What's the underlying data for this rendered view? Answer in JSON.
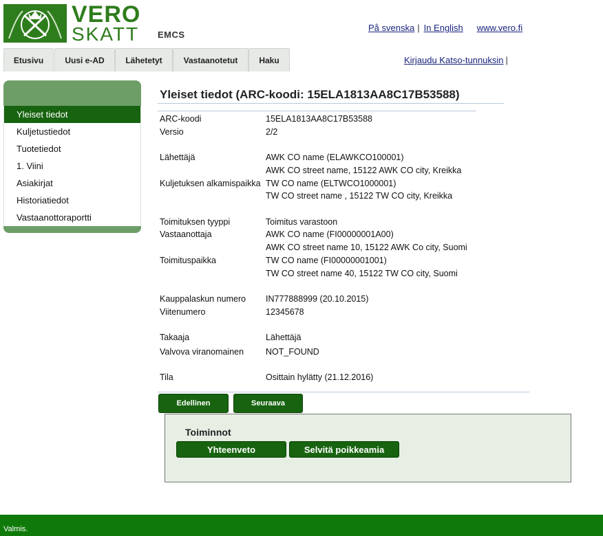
{
  "logo": {
    "line1": "VERO",
    "line2": "SKATT"
  },
  "app_title": "EMCS",
  "header_links": {
    "svenska": "På svenska",
    "english": "In English",
    "vero": "www.vero.fi",
    "separator": "|"
  },
  "tabs": [
    {
      "label": "Etusivu"
    },
    {
      "label": "Uusi e-AD"
    },
    {
      "label": "Lähetetyt"
    },
    {
      "label": "Vastaanotetut"
    },
    {
      "label": "Haku"
    }
  ],
  "login": {
    "label": "Kirjaudu Katso-tunnuksin",
    "separator": "|"
  },
  "sidebar": {
    "items": [
      {
        "label": "Yleiset tiedot",
        "active": true
      },
      {
        "label": "Kuljetustiedot"
      },
      {
        "label": "Tuotetiedot"
      },
      {
        "label": "1. Viini"
      },
      {
        "label": "Asiakirjat"
      },
      {
        "label": "Historiatiedot"
      },
      {
        "label": "Vastaanottoraportti"
      }
    ]
  },
  "page_title": "Yleiset tiedot (ARC-koodi: 15ELA1813AA8C17B53588)",
  "details": {
    "arc_label": "ARC-koodi",
    "arc_value": "15ELA1813AA8C17B53588",
    "version_label": "Versio",
    "version_value": "2/2",
    "sender_label": "Lähettäjä",
    "sender_name": "AWK CO name (ELAWKCO100001)",
    "sender_address": "AWK CO street name, 15122 AWK CO city, Kreikka",
    "dispatch_label": "Kuljetuksen alkamispaikka",
    "dispatch_name": "TW CO name (ELTWCO1000001)",
    "dispatch_address": "TW CO street name , 15122 TW CO city, Kreikka",
    "delivery_type_label": "Toimituksen tyyppi",
    "delivery_type_value": "Toimitus varastoon",
    "consignee_label": "Vastaanottaja",
    "consignee_name": "AWK CO name (FI00000001A00)",
    "consignee_address": "AWK CO street name 10, 15122 AWK Co city, Suomi",
    "delivery_place_label": "Toimituspaikka",
    "delivery_place_name": "TW CO name (FI00000001001)",
    "delivery_place_address": "TW CO street name 40, 15122 TW CO city, Suomi",
    "invoice_label": "Kauppalaskun numero",
    "invoice_value": "IN777888999 (20.10.2015)",
    "reference_label": "Viitenumero",
    "reference_value": "12345678",
    "guarantor_label": "Takaaja",
    "guarantor_value": "Lähettäjä",
    "authority_label": "Valvova viranomainen",
    "authority_value": "NOT_FOUND",
    "status_label": "Tila",
    "status_value": "Osittain hylätty (21.12.2016)"
  },
  "nav_buttons": {
    "previous": "Edellinen",
    "next": "Seuraava"
  },
  "actions": {
    "title": "Toiminnot",
    "summary": "Yhteenveto",
    "explain": "Selvitä poikkeamia"
  },
  "statusbar": {
    "text": "Valmis."
  },
  "colors": {
    "brand_green": "#2e7d1c",
    "dark_green": "#17630f",
    "status_green": "#0f7a0a"
  }
}
